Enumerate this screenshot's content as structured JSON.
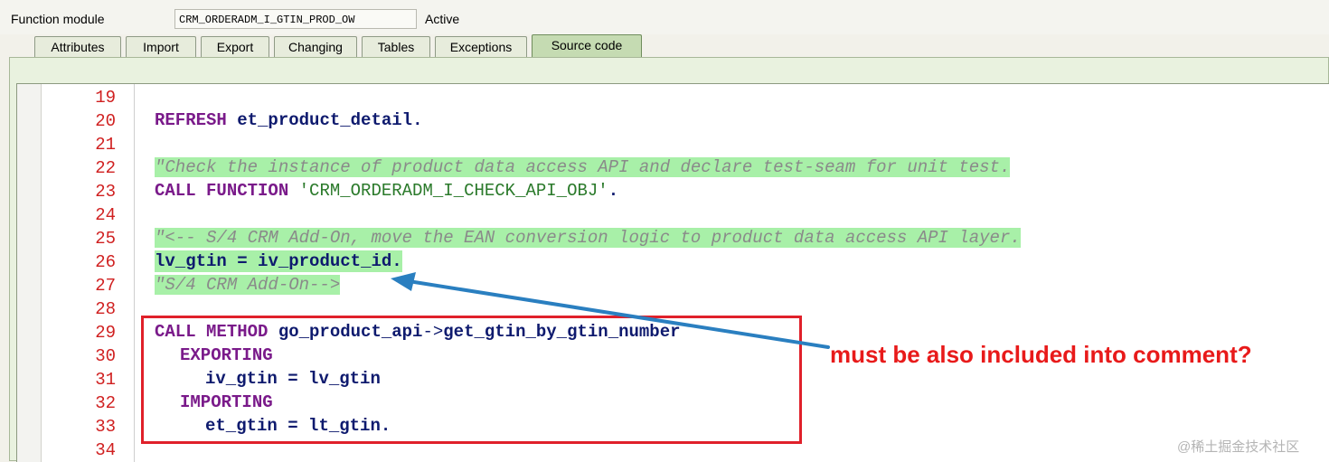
{
  "header": {
    "function_module_label": "Function module",
    "function_module_value": "CRM_ORDERADM_I_GTIN_PROD_OW",
    "status": "Active"
  },
  "tabs": [
    {
      "label": "Attributes",
      "active": false
    },
    {
      "label": "Import",
      "active": false
    },
    {
      "label": "Export",
      "active": false
    },
    {
      "label": "Changing",
      "active": false
    },
    {
      "label": "Tables",
      "active": false
    },
    {
      "label": "Exceptions",
      "active": false
    },
    {
      "label": "Source code",
      "active": true
    }
  ],
  "editor": {
    "line_numbers": [
      "19",
      "20",
      "21",
      "22",
      "23",
      "24",
      "25",
      "26",
      "27",
      "28",
      "29",
      "30",
      "31",
      "32",
      "33",
      "34"
    ],
    "code": {
      "l20_kw": "REFRESH",
      "l20_var": " et_product_detail",
      "l20_end": ".",
      "l22_comment": "\"Check the instance of product data access API and declare test-seam for unit test.",
      "l23_kw": "CALL FUNCTION",
      "l23_str": " 'CRM_ORDERADM_I_CHECK_API_OBJ'",
      "l23_end": ".",
      "l25_comment": "\"<-- S/4 CRM Add-On, move the EAN conversion logic to product data access API layer.",
      "l26_a": "lv_gtin",
      "l26_op": " = ",
      "l26_b": "iv_product_id",
      "l26_end": ".",
      "l27_comment": "\"S/4 CRM Add-On-->",
      "l29_kw": "CALL METHOD",
      "l29_obj": " go_product_api",
      "l29_arrow": "->",
      "l29_meth": "get_gtin_by_gtin_number",
      "l30_kw": "EXPORTING",
      "l31_a": "iv_gtin",
      "l31_op": " = ",
      "l31_b": "lv_gtin",
      "l32_kw": "IMPORTING",
      "l33_a": "et_gtin",
      "l33_op": " = ",
      "l33_b": "lt_gtin",
      "l33_end": "."
    }
  },
  "annotation": {
    "text": "must be also included into comment?",
    "color": "#e81a1a",
    "box_color": "#e0202a",
    "arrow_color": "#2a7fc0"
  },
  "watermark": "@稀土掘金技术社区",
  "colors": {
    "keyword": "#7a1a8a",
    "variable": "#0e1a6e",
    "string": "#2b7a2b",
    "comment": "#8a8a8a",
    "comment_highlight": "#a8f0a8",
    "line_number": "#d02020",
    "active_tab": "#c5dbb2"
  }
}
